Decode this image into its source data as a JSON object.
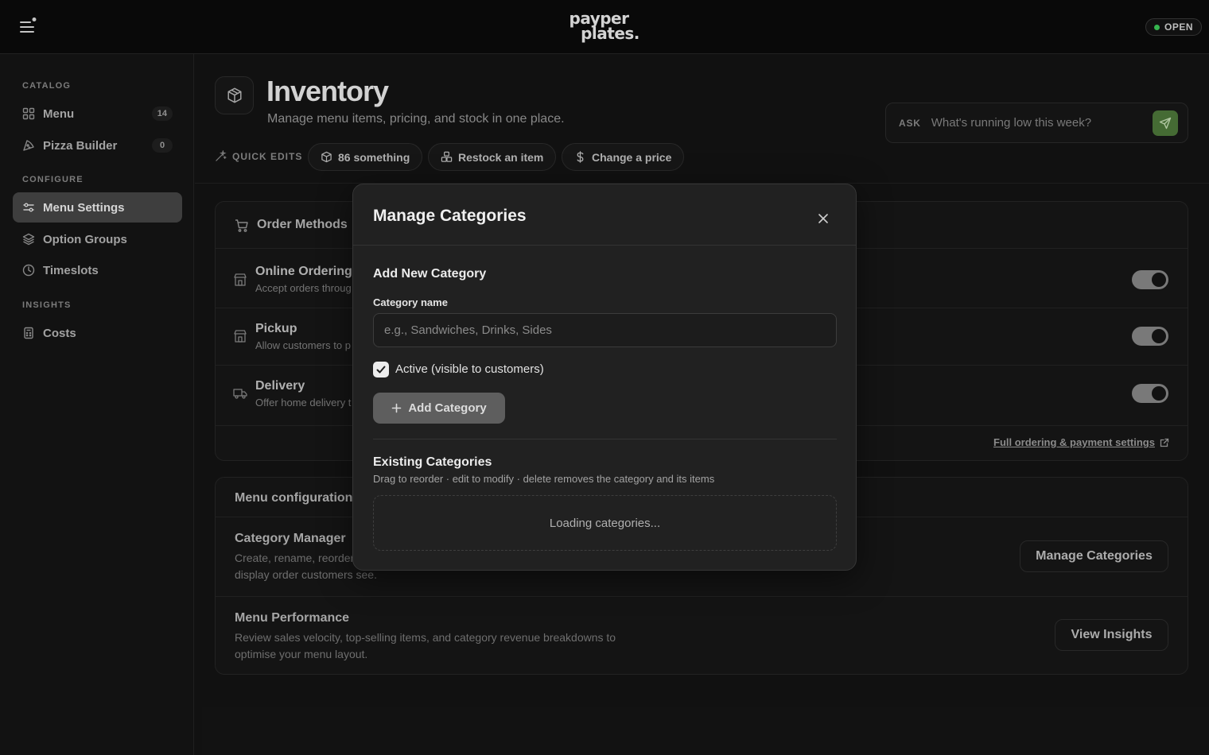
{
  "topbar": {
    "brand_line1": "payper",
    "brand_line2": "plates.",
    "status": "OPEN",
    "status_color": "#3ecf5b"
  },
  "sidebar": {
    "sections": [
      {
        "label": "CATALOG",
        "items": [
          {
            "label": "Menu",
            "count": "14",
            "icon": "grid-icon"
          },
          {
            "label": "Pizza Builder",
            "count": "0",
            "icon": "pizza-icon"
          }
        ]
      },
      {
        "label": "CONFIGURE",
        "items": [
          {
            "label": "Menu Settings",
            "icon": "sliders-icon",
            "active": true
          },
          {
            "label": "Option Groups",
            "icon": "layers-icon"
          },
          {
            "label": "Timeslots",
            "icon": "clock-icon"
          }
        ]
      },
      {
        "label": "INSIGHTS",
        "items": [
          {
            "label": "Costs",
            "icon": "calculator-icon"
          }
        ]
      }
    ]
  },
  "header": {
    "title": "Inventory",
    "subtitle": "Manage menu items, pricing, and stock in one place.",
    "ask_label": "ASK",
    "ask_placeholder": "What's running low this week?",
    "accent_color": "#4f7a3c"
  },
  "quick_edits": {
    "label": "QUICK EDITS",
    "chips": [
      {
        "label": "86 something",
        "icon": "box-icon"
      },
      {
        "label": "Restock an item",
        "icon": "boxes-icon"
      },
      {
        "label": "Change a price",
        "icon": "dollar-icon"
      }
    ]
  },
  "order_methods": {
    "title": "Order Methods",
    "rows": [
      {
        "title": "Online Ordering",
        "desc": "Accept orders throug",
        "enabled": true,
        "icon": "store-icon"
      },
      {
        "title": "Pickup",
        "desc": "Allow customers to p",
        "enabled": true,
        "icon": "store-icon"
      },
      {
        "title": "Delivery",
        "desc": "Offer home delivery t",
        "enabled": true,
        "icon": "truck-icon"
      }
    ],
    "footer_link": "Full ordering & payment settings"
  },
  "menu_config": {
    "title": "Menu configuration",
    "category_manager": {
      "title": "Category Manager",
      "desc_line1": "Create, rename, reorder",
      "desc_line2": "display order customers see.",
      "button": "Manage Categories"
    },
    "menu_performance": {
      "title": "Menu Performance",
      "desc_line1": "Review sales velocity, top-selling items, and category revenue breakdowns to",
      "desc_line2": "optimise your menu layout.",
      "button": "View Insights"
    }
  },
  "modal": {
    "title": "Manage Categories",
    "add_section_title": "Add New Category",
    "name_label": "Category name",
    "name_placeholder": "e.g., Sandwiches, Drinks, Sides",
    "name_value": "",
    "active_label": "Active (visible to customers)",
    "active_checked": true,
    "add_button": "Add Category",
    "existing_title": "Existing Categories",
    "existing_help": "Drag to reorder · edit to modify · delete removes the category and its items",
    "loading_text": "Loading categories..."
  }
}
